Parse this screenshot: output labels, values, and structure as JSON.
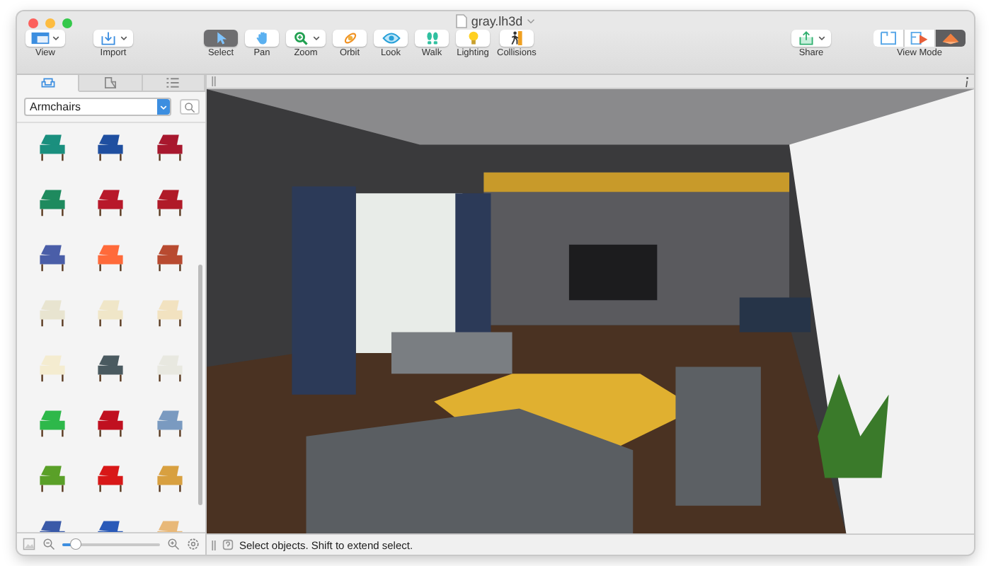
{
  "window": {
    "title": "gray.lh3d"
  },
  "toolbar": {
    "left": [
      {
        "label": "View",
        "menu": true
      },
      {
        "label": "Import",
        "menu": true
      }
    ],
    "tools": [
      {
        "label": "Select",
        "selected": true,
        "menu": false
      },
      {
        "label": "Pan",
        "selected": false,
        "menu": false
      },
      {
        "label": "Zoom",
        "selected": false,
        "menu": true
      },
      {
        "label": "Orbit",
        "selected": false,
        "menu": false
      },
      {
        "label": "Look",
        "selected": false,
        "menu": false
      },
      {
        "label": "Walk",
        "selected": false,
        "menu": false
      },
      {
        "label": "Lighting",
        "selected": false,
        "menu": false
      },
      {
        "label": "Collisions",
        "selected": false,
        "menu": false
      }
    ],
    "share": {
      "label": "Share",
      "menu": true
    },
    "view_mode": {
      "label": "View Mode",
      "segments": [
        {
          "selected": false
        },
        {
          "selected": false
        },
        {
          "selected": true
        }
      ]
    }
  },
  "sidebar": {
    "tabs": [
      {
        "selected": true
      },
      {
        "selected": false
      },
      {
        "selected": false
      }
    ],
    "category": {
      "value": "Armchairs"
    },
    "catalog": [
      {
        "color": "#1a8f7e"
      },
      {
        "color": "#1f4fa0"
      },
      {
        "color": "#a8182e"
      },
      {
        "color": "#1e8a5e"
      },
      {
        "color": "#b8182a"
      },
      {
        "color": "#b01a28"
      },
      {
        "color": "#4a5ea8"
      },
      {
        "color": "#ff6a3a"
      },
      {
        "color": "#b84a30"
      },
      {
        "color": "#e8e4d0"
      },
      {
        "color": "#f0e6c8"
      },
      {
        "color": "#f2e2c0"
      },
      {
        "color": "#f4ecd0"
      },
      {
        "color": "#4a5a60"
      },
      {
        "color": "#e8e8e0"
      },
      {
        "color": "#2eb84a"
      },
      {
        "color": "#c01020"
      },
      {
        "color": "#7a9ac0"
      },
      {
        "color": "#5aa028"
      },
      {
        "color": "#d81818"
      },
      {
        "color": "#d8a040"
      },
      {
        "color": "#3a5aa8"
      },
      {
        "color": "#2a5ab8"
      },
      {
        "color": "#e8b878"
      }
    ],
    "icon_size": {
      "level": 0.15
    }
  },
  "status_bar": {
    "text": "Select objects. Shift to extend select."
  }
}
